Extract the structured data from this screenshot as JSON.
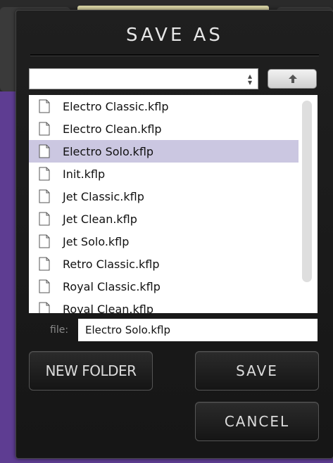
{
  "dialog": {
    "title": "SAVE AS"
  },
  "path_selector": {
    "value": ""
  },
  "files": [
    {
      "name": "Electro Classic.kflp",
      "selected": false
    },
    {
      "name": "Electro Clean.kflp",
      "selected": false
    },
    {
      "name": "Electro Solo.kflp",
      "selected": true
    },
    {
      "name": "Init.kflp",
      "selected": false
    },
    {
      "name": "Jet Classic.kflp",
      "selected": false
    },
    {
      "name": "Jet Clean.kflp",
      "selected": false
    },
    {
      "name": "Jet Solo.kflp",
      "selected": false
    },
    {
      "name": "Retro Classic.kflp",
      "selected": false
    },
    {
      "name": "Royal Classic.kflp",
      "selected": false
    },
    {
      "name": "Royal Clean.kflp",
      "selected": false
    }
  ],
  "file_field": {
    "label": "file:",
    "value": "Electro Solo.kflp"
  },
  "buttons": {
    "new_folder": "NEW FOLDER",
    "save": "SAVE",
    "cancel": "CANCEL"
  },
  "icons": {
    "up": "arrow-up-icon",
    "select": "select-arrows-icon",
    "file": "document-icon"
  },
  "colors": {
    "selection": "#cbc7e1",
    "dialog_bg": "#1a1a1a",
    "host_purple": "#5e3d92"
  }
}
